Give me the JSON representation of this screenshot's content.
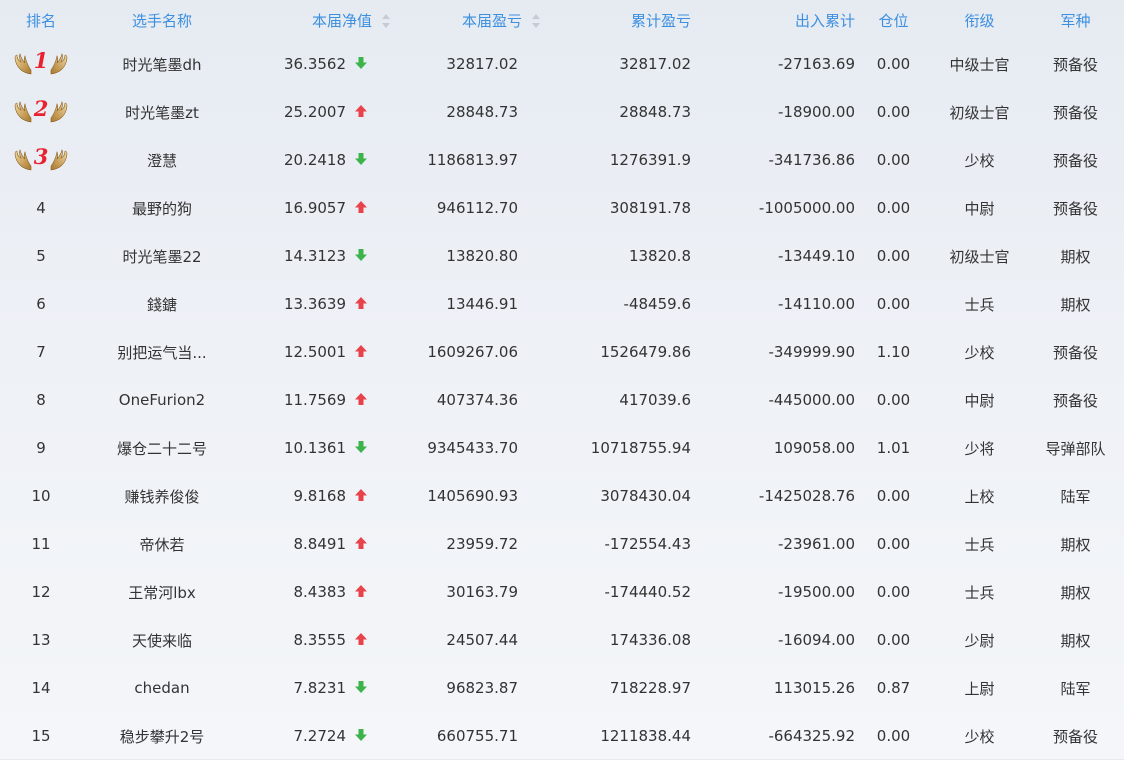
{
  "header": {
    "rank": "排名",
    "name": "选手名称",
    "nav": "本届净值",
    "season_pl": "本届盈亏",
    "total_pl": "累计盈亏",
    "flow": "出入累计",
    "position": "仓位",
    "title": "衔级",
    "branch": "军种"
  },
  "colors": {
    "header_text": "#3d8fe0",
    "up": "#e8424a",
    "down": "#3cb44b",
    "medal_number": "#e8232f"
  },
  "rows": [
    {
      "rank": "1",
      "name": "时光笔墨dh",
      "nav": "36.3562",
      "trend": "down",
      "season_pl": "32817.02",
      "total_pl": "32817.02",
      "flow": "-27163.69",
      "position": "0.00",
      "title": "中级士官",
      "branch": "预备役"
    },
    {
      "rank": "2",
      "name": "时光笔墨zt",
      "nav": "25.2007",
      "trend": "up",
      "season_pl": "28848.73",
      "total_pl": "28848.73",
      "flow": "-18900.00",
      "position": "0.00",
      "title": "初级士官",
      "branch": "预备役"
    },
    {
      "rank": "3",
      "name": "澄慧",
      "nav": "20.2418",
      "trend": "down",
      "season_pl": "1186813.97",
      "total_pl": "1276391.9",
      "flow": "-341736.86",
      "position": "0.00",
      "title": "少校",
      "branch": "预备役"
    },
    {
      "rank": "4",
      "name": "最野的狗",
      "nav": "16.9057",
      "trend": "up",
      "season_pl": "946112.70",
      "total_pl": "308191.78",
      "flow": "-1005000.00",
      "position": "0.00",
      "title": "中尉",
      "branch": "预备役"
    },
    {
      "rank": "5",
      "name": "时光笔墨22",
      "nav": "14.3123",
      "trend": "down",
      "season_pl": "13820.80",
      "total_pl": "13820.8",
      "flow": "-13449.10",
      "position": "0.00",
      "title": "初级士官",
      "branch": "期权"
    },
    {
      "rank": "6",
      "name": "錢鎕",
      "nav": "13.3639",
      "trend": "up",
      "season_pl": "13446.91",
      "total_pl": "-48459.6",
      "flow": "-14110.00",
      "position": "0.00",
      "title": "士兵",
      "branch": "期权"
    },
    {
      "rank": "7",
      "name": "别把运气当...",
      "nav": "12.5001",
      "trend": "up",
      "season_pl": "1609267.06",
      "total_pl": "1526479.86",
      "flow": "-349999.90",
      "position": "1.10",
      "title": "少校",
      "branch": "预备役"
    },
    {
      "rank": "8",
      "name": "OneFurion2",
      "nav": "11.7569",
      "trend": "up",
      "season_pl": "407374.36",
      "total_pl": "417039.6",
      "flow": "-445000.00",
      "position": "0.00",
      "title": "中尉",
      "branch": "预备役"
    },
    {
      "rank": "9",
      "name": "爆仓二十二号",
      "nav": "10.1361",
      "trend": "down",
      "season_pl": "9345433.70",
      "total_pl": "10718755.94",
      "flow": "109058.00",
      "position": "1.01",
      "title": "少将",
      "branch": "导弹部队"
    },
    {
      "rank": "10",
      "name": "赚钱养俊俊",
      "nav": "9.8168",
      "trend": "up",
      "season_pl": "1405690.93",
      "total_pl": "3078430.04",
      "flow": "-1425028.76",
      "position": "0.00",
      "title": "上校",
      "branch": "陆军"
    },
    {
      "rank": "11",
      "name": "帝休若",
      "nav": "8.8491",
      "trend": "up",
      "season_pl": "23959.72",
      "total_pl": "-172554.43",
      "flow": "-23961.00",
      "position": "0.00",
      "title": "士兵",
      "branch": "期权"
    },
    {
      "rank": "12",
      "name": "王常河lbx",
      "nav": "8.4383",
      "trend": "up",
      "season_pl": "30163.79",
      "total_pl": "-174440.52",
      "flow": "-19500.00",
      "position": "0.00",
      "title": "士兵",
      "branch": "期权"
    },
    {
      "rank": "13",
      "name": "天使来临",
      "nav": "8.3555",
      "trend": "up",
      "season_pl": "24507.44",
      "total_pl": "174336.08",
      "flow": "-16094.00",
      "position": "0.00",
      "title": "少尉",
      "branch": "期权"
    },
    {
      "rank": "14",
      "name": "chedan",
      "nav": "7.8231",
      "trend": "down",
      "season_pl": "96823.87",
      "total_pl": "718228.97",
      "flow": "113015.26",
      "position": "0.87",
      "title": "上尉",
      "branch": "陆军"
    },
    {
      "rank": "15",
      "name": "稳步攀升2号",
      "nav": "7.2724",
      "trend": "down",
      "season_pl": "660755.71",
      "total_pl": "1211838.44",
      "flow": "-664325.92",
      "position": "0.00",
      "title": "少校",
      "branch": "预备役"
    }
  ]
}
